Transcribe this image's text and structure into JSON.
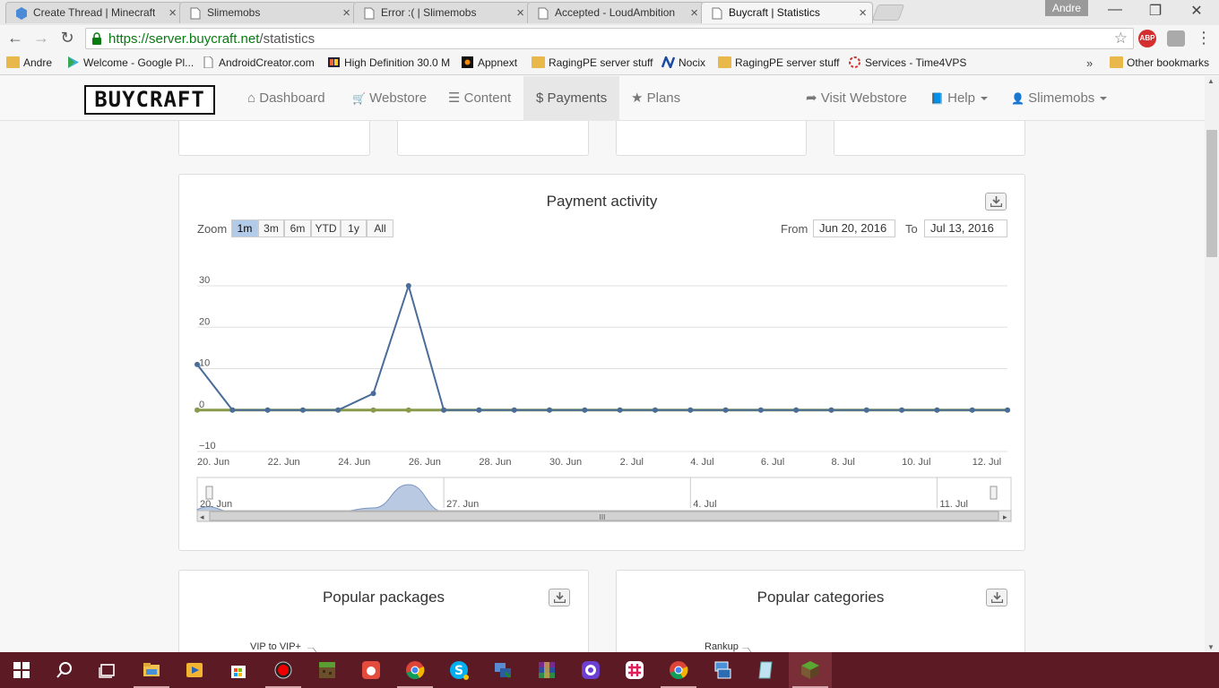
{
  "browser": {
    "tabs": [
      {
        "label": "Create Thread | Minecraft",
        "active": false
      },
      {
        "label": "Slimemobs",
        "active": false
      },
      {
        "label": "Error :( | Slimemobs",
        "active": false
      },
      {
        "label": "Accepted - LoudAmbition",
        "active": false
      },
      {
        "label": "Buycraft | Statistics",
        "active": true
      }
    ],
    "tab_close": "×",
    "profile_name": "Andre",
    "window_controls": {
      "minimize": "—",
      "restore": "❐",
      "close": "✕"
    },
    "url_host": "https://server.buycraft.net",
    "url_path": "/statistics",
    "abp_label": "ABP",
    "menu_glyph": "⋮",
    "nav_glyphs": {
      "back": "←",
      "forward": "→",
      "reload": "↻",
      "star": "☆"
    },
    "bookmarks": [
      {
        "label": "Andre",
        "icon": "folder-icon"
      },
      {
        "label": "Welcome - Google Pl...",
        "icon": "google-play-icon"
      },
      {
        "label": "AndroidCreator.com",
        "icon": "page-icon"
      },
      {
        "label": "High Definition 30.0 M",
        "icon": "hd-icon"
      },
      {
        "label": "Appnext",
        "icon": "appnext-icon"
      },
      {
        "label": "RagingPE server stuff",
        "icon": "folder-icon"
      },
      {
        "label": "Nocix",
        "icon": "nocix-icon"
      },
      {
        "label": "RagingPE server stuff",
        "icon": "folder-icon"
      },
      {
        "label": "Services - Time4VPS",
        "icon": "time4vps-icon"
      }
    ],
    "bookmarks_overflow": "»",
    "other_bookmarks": "Other bookmarks"
  },
  "site": {
    "logo": "BUYCRAFT",
    "nav": {
      "dashboard": "Dashboard",
      "webstore": "Webstore",
      "content": "Content",
      "payments": "Payments",
      "plans": "Plans",
      "visit_webstore": "Visit Webstore",
      "help": "Help",
      "user": "Slimemobs"
    },
    "nav_icons": {
      "dashboard": "⌂",
      "webstore": "🛒",
      "content": "☰",
      "payments": "$",
      "plans": "★",
      "visit_webstore": "➦",
      "help": "📘",
      "user": "👤"
    }
  },
  "payment_panel": {
    "title": "Payment activity",
    "zoom_label": "Zoom",
    "zoom_options": [
      "1m",
      "3m",
      "6m",
      "YTD",
      "1y",
      "All"
    ],
    "zoom_selected": "1m",
    "from_label": "From",
    "from_value": "Jun 20, 2016",
    "to_label": "To",
    "to_value": "Jul 13, 2016"
  },
  "chart_data": {
    "type": "line",
    "ylim": [
      -10,
      30
    ],
    "yticks": [
      -10,
      0,
      10,
      20,
      30
    ],
    "ytick_labels": [
      "−10",
      "0",
      "10",
      "20",
      "30"
    ],
    "x": [
      "2016-06-20",
      "2016-06-21",
      "2016-06-22",
      "2016-06-23",
      "2016-06-24",
      "2016-06-25",
      "2016-06-26",
      "2016-06-27",
      "2016-06-28",
      "2016-06-29",
      "2016-06-30",
      "2016-07-01",
      "2016-07-02",
      "2016-07-03",
      "2016-07-04",
      "2016-07-05",
      "2016-07-06",
      "2016-07-07",
      "2016-07-08",
      "2016-07-09",
      "2016-07-10",
      "2016-07-11",
      "2016-07-12",
      "2016-07-13"
    ],
    "xtick_labels": [
      "20. Jun",
      "22. Jun",
      "24. Jun",
      "26. Jun",
      "28. Jun",
      "30. Jun",
      "2. Jul",
      "4. Jul",
      "6. Jul",
      "8. Jul",
      "10. Jul",
      "12. Jul"
    ],
    "grid": true,
    "legend": "none",
    "series": [
      {
        "values": [
          11,
          0,
          0,
          0,
          0,
          4,
          30,
          0,
          0,
          0,
          0,
          0,
          0,
          0,
          0,
          0,
          0,
          0,
          0,
          0,
          0,
          0,
          0,
          0
        ],
        "color": "#4a6c98"
      },
      {
        "values": [
          0,
          0,
          0,
          0,
          0,
          0,
          0,
          0,
          0,
          0,
          0,
          0,
          0,
          0,
          0,
          0,
          0,
          0,
          0,
          0,
          0,
          0,
          0,
          0
        ],
        "color": "#8a9a4c"
      }
    ],
    "navigator_labels": [
      "20. Jun",
      "27. Jun",
      "4. Jul",
      "11. Jul"
    ],
    "navigator_scroll_glyph": "III",
    "navigator_arrow_left": "◂",
    "navigator_arrow_right": "▸"
  },
  "packages_panel": {
    "title": "Popular packages",
    "first_label": "VIP to VIP+"
  },
  "categories_panel": {
    "title": "Popular categories",
    "first_label": "Rankup"
  },
  "taskbar": {
    "items": [
      "start-icon",
      "search-icon",
      "task-view-icon",
      "file-explorer-icon",
      "media-player-icon",
      "store-icon",
      "record-icon",
      "minecraft-icon",
      "gift-icon",
      "chrome-icon",
      "skype-icon",
      "network-icon",
      "winrar-icon",
      "app-purple-icon",
      "slack-icon",
      "chrome-icon",
      "remote-desktop-icon",
      "notepad-icon",
      "minecraft-block-icon"
    ]
  },
  "colors": {
    "accent_series": "#4a6c98",
    "zero_series": "#8a9a4c",
    "taskbar": "#5c1a24",
    "url_green": "#0a7a12"
  }
}
